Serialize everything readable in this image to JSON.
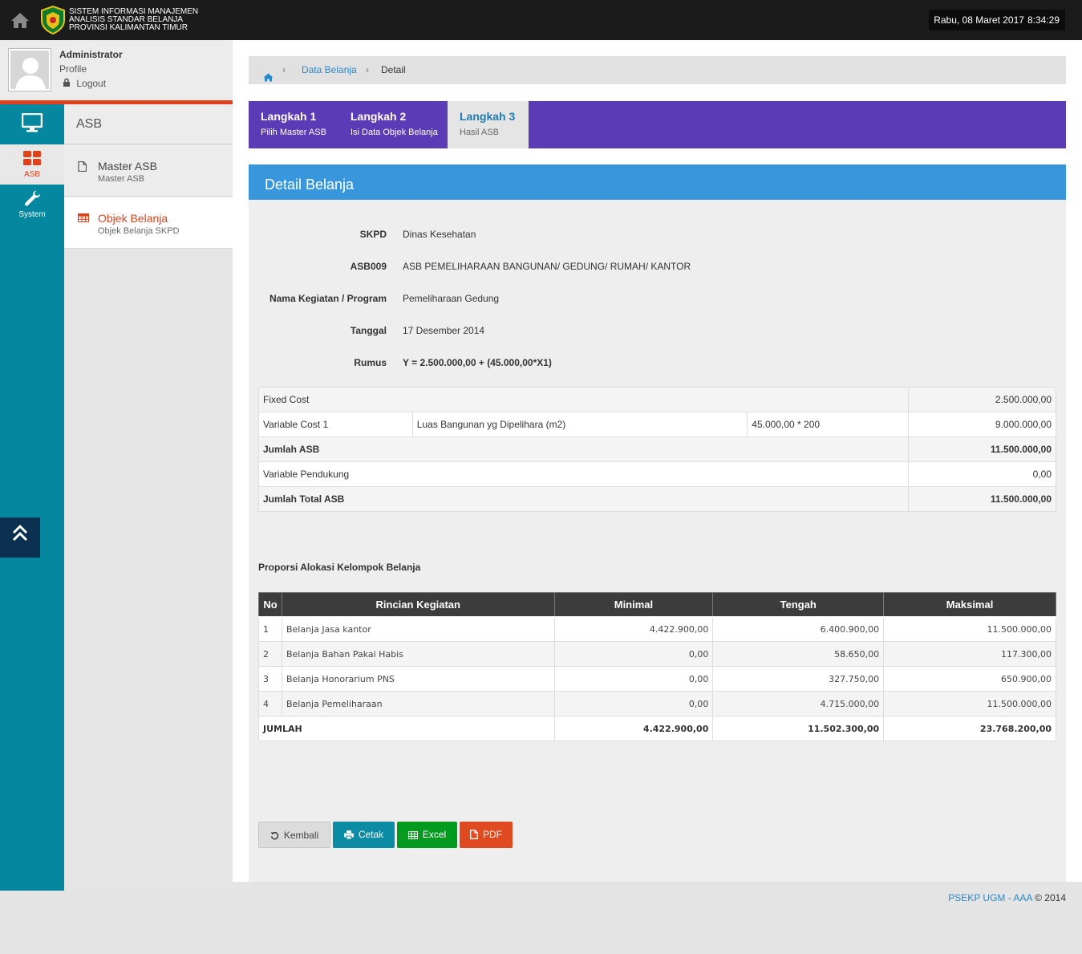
{
  "header": {
    "brand_lines": [
      "SISTEM INFORMASI MANAJEMEN",
      "ANALISIS STANDAR BELANJA",
      "PROVINSI KALIMANTAN TIMUR"
    ],
    "date": "Rabu, 08 Maret 2017",
    "time": "8:34:29"
  },
  "user": {
    "name": "Administrator",
    "profile_label": "Profile",
    "logout_label": "Logout"
  },
  "rail": {
    "asb_label": "ASB",
    "system_label": "System"
  },
  "submenu": {
    "title": "ASB",
    "items": [
      {
        "label": "Master ASB",
        "sub": "Master ASB"
      },
      {
        "label": "Objek Belanja",
        "sub": "Objek Belanja SKPD"
      }
    ]
  },
  "breadcrumb": {
    "link": "Data Belanja",
    "current": "Detail"
  },
  "steps": [
    {
      "title": "Langkah 1",
      "sub": "Pilih Master ASB"
    },
    {
      "title": "Langkah 2",
      "sub": "Isi Data Objek Belanja"
    },
    {
      "title": "Langkah 3",
      "sub": "Hasil ASB"
    }
  ],
  "panel": {
    "title": "Detail Belanja",
    "fields": [
      {
        "label": "SKPD",
        "value": "Dinas Kesehatan"
      },
      {
        "label": "ASB009",
        "value": "ASB PEMELIHARAAN BANGUNAN/ GEDUNG/ RUMAH/ KANTOR"
      },
      {
        "label": "Nama Kegiatan / Program",
        "value": "Pemeliharaan Gedung"
      },
      {
        "label": "Tanggal",
        "value": "17 Desember 2014"
      },
      {
        "label": "Rumus",
        "value": "Y = 2.500.000,00 + (45.000,00*X1)"
      }
    ]
  },
  "cost_table": {
    "fixed_label": "Fixed Cost",
    "fixed_value": "2.500.000,00",
    "var1_label": "Variable Cost 1",
    "var1_desc": "Luas Bangunan yg Dipelihara (m2)",
    "var1_formula": "45.000,00 * 200",
    "var1_value": "9.000.000,00",
    "jumlah_label": "Jumlah ASB",
    "jumlah_value": "11.500.000,00",
    "pendukung_label": "Variable Pendukung",
    "pendukung_value": "0,00",
    "total_label": "Jumlah Total ASB",
    "total_value": "11.500.000,00"
  },
  "proporsi": {
    "title": "Proporsi Alokasi Kelompok Belanja",
    "headers": [
      "No",
      "Rincian Kegiatan",
      "Minimal",
      "Tengah",
      "Maksimal"
    ],
    "rows": [
      {
        "no": "1",
        "name": "Belanja Jasa kantor",
        "min": "4.422.900,00",
        "mid": "6.400.900,00",
        "max": "11.500.000,00"
      },
      {
        "no": "2",
        "name": "Belanja Bahan Pakai Habis",
        "min": "0,00",
        "mid": "58.650,00",
        "max": "117.300,00"
      },
      {
        "no": "3",
        "name": "Belanja Honorarium PNS",
        "min": "0,00",
        "mid": "327.750,00",
        "max": "650.900,00"
      },
      {
        "no": "4",
        "name": "Belanja Pemeliharaan",
        "min": "0,00",
        "mid": "4.715.000,00",
        "max": "11.500.000,00"
      }
    ],
    "total": {
      "label": "JUMLAH",
      "min": "4.422.900,00",
      "mid": "11.502.300,00",
      "max": "23.768.200,00"
    }
  },
  "buttons": {
    "back": "Kembali",
    "print": "Cetak",
    "excel": "Excel",
    "pdf": "PDF"
  },
  "footer": {
    "link": "PSEKP UGM - AAA",
    "copy": "© 2014"
  },
  "colors": {
    "topbar": "#1b1b1b",
    "rail": "#05889f",
    "accent_red": "#e0421c",
    "steps_purple": "#5c3bb6",
    "panel_head_blue": "#3897dc",
    "link_blue": "#2a88c9",
    "btn_print": "#0c8ba5",
    "btn_excel": "#039b1f",
    "btn_pdf": "#df4a20"
  },
  "icons": [
    "home-icon",
    "logo-emblem-icon",
    "avatar-icon",
    "lock-icon",
    "monitor-icon",
    "grid-icon",
    "wrench-icon",
    "chevron-up-double-icon",
    "file-icon",
    "table-icon",
    "undo-icon",
    "print-icon",
    "excel-table-icon",
    "pdf-file-icon"
  ]
}
